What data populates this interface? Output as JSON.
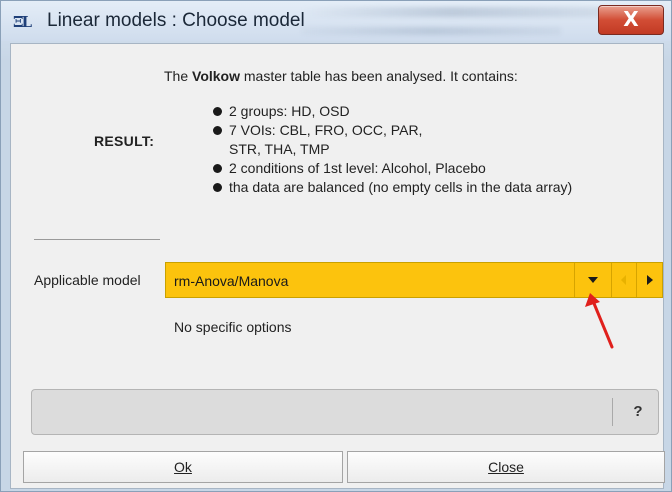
{
  "window": {
    "title": "Linear models : Choose model",
    "app_icon": "ΞL",
    "close_glyph": "X"
  },
  "summary": {
    "prefix": "The ",
    "table_name": "Volkow",
    "suffix": " master table has been analysed. It contains:"
  },
  "result": {
    "label": "RESULT:",
    "items": [
      "2 groups: HD, OSD",
      "7 VOIs: CBL, FRO, OCC, PAR,",
      "STR, THA, TMP",
      "2 conditions of 1st level: Alcohol, Placebo",
      "tha data are balanced (no empty cells in the data array)"
    ]
  },
  "model": {
    "label": "Applicable model",
    "value": "rm-Anova/Manova",
    "combo_color": "#fcc30d",
    "icons": [
      "dropdown-arrow-icon",
      "previous-arrow-icon",
      "next-arrow-icon"
    ]
  },
  "options": {
    "text": "No specific options"
  },
  "status_bar": {
    "message": "",
    "help_label": "?"
  },
  "buttons": {
    "ok": "Ok",
    "close": "Close"
  },
  "annotation": {
    "arrow_color": "#e0201c"
  }
}
